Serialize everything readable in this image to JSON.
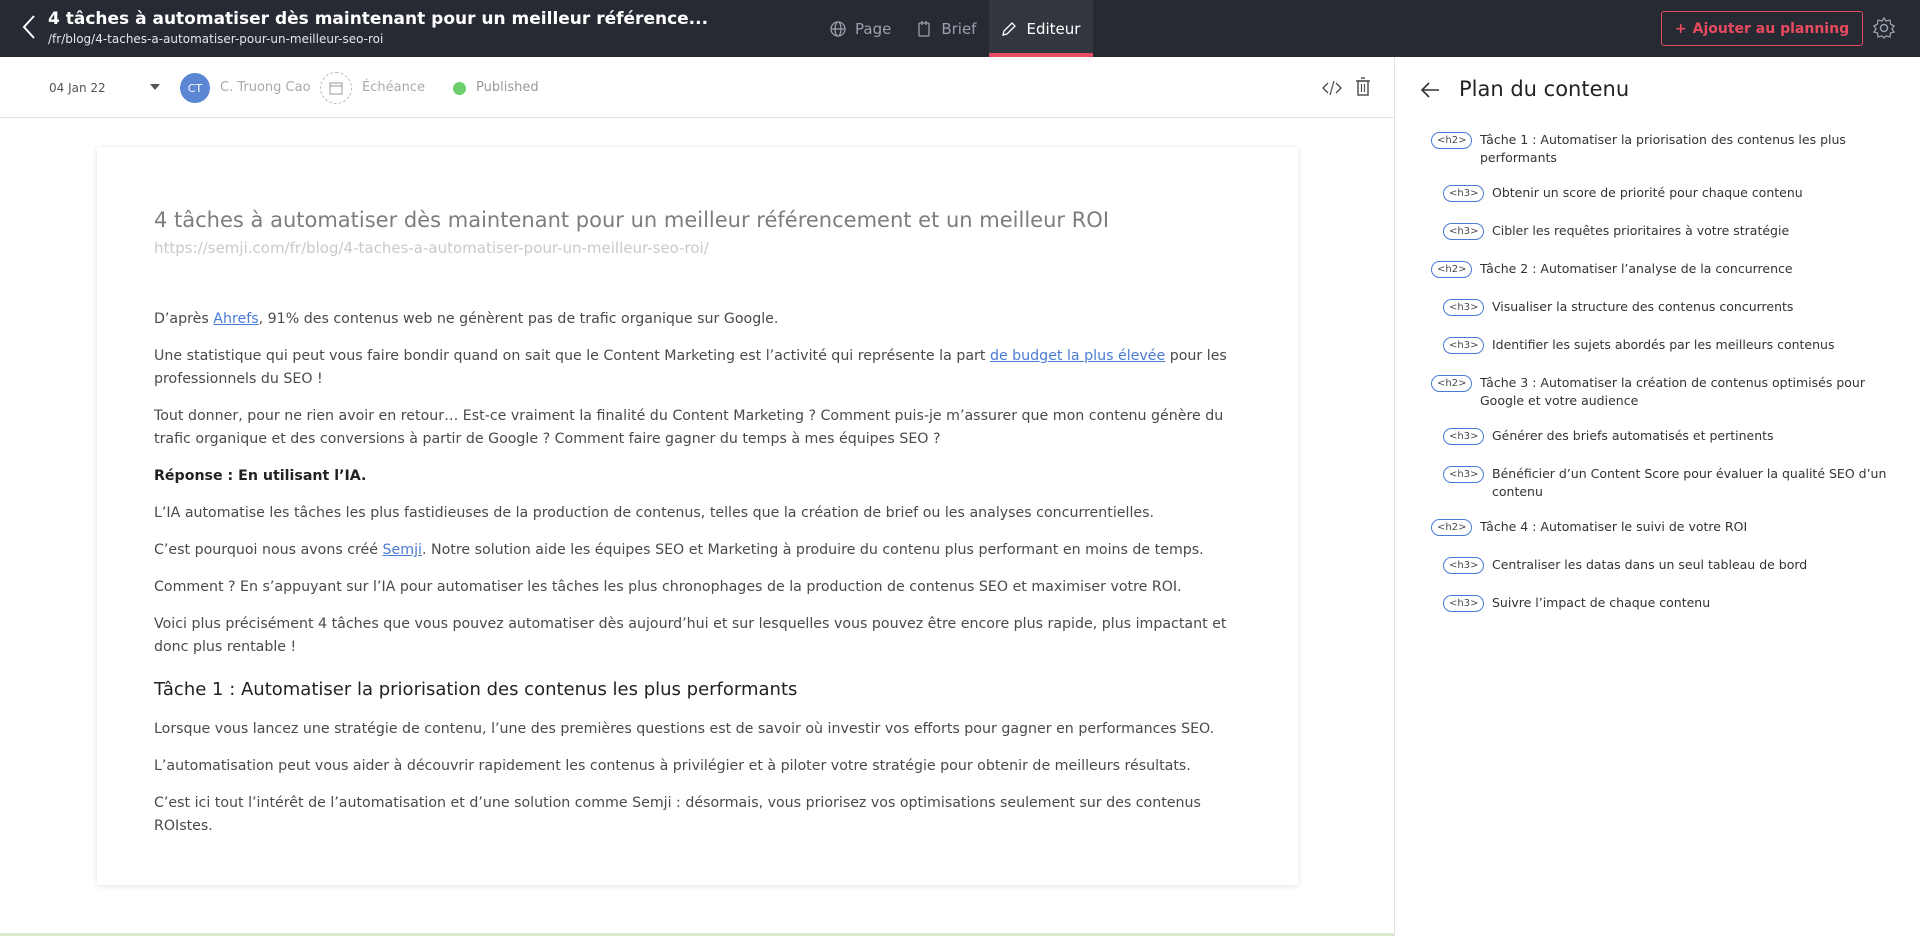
{
  "topbar": {
    "title": "4 tâches à automatiser dès maintenant pour un meilleur référence...",
    "path": "/fr/blog/4-taches-a-automatiser-pour-un-meilleur-seo-roi",
    "tabs": [
      {
        "label": "Page",
        "icon": "globe-icon"
      },
      {
        "label": "Brief",
        "icon": "brief-icon"
      },
      {
        "label": "Editeur",
        "icon": "pencil-icon",
        "active": true
      }
    ],
    "planning_button": "Ajouter au planning",
    "accent": "#e84a5f"
  },
  "meta": {
    "date": "04 Jan 22",
    "avatar_initials": "CT",
    "author": "C. Truong Cao",
    "deadline_label": "Échéance",
    "status": "Published",
    "status_color": "#6dcf6b"
  },
  "document": {
    "title": "4 tâches à automatiser dès maintenant pour un meilleur référencement et un meilleur ROI",
    "url": "https://semji.com/fr/blog/4-taches-a-automatiser-pour-un-meilleur-seo-roi/",
    "p1_pre": "D’après ",
    "p1_link": "Ahrefs",
    "p1_post": ", 91% des contenus web ne génèrent pas de trafic organique sur Google.",
    "p2_pre": "Une statistique qui peut vous faire bondir quand on sait que le Content Marketing est l’activité qui représente la part ",
    "p2_link": "de budget la plus élevée",
    "p2_post": " pour les professionnels du SEO !",
    "p3": "Tout donner, pour ne rien avoir en retour… Est-ce vraiment la finalité du Content Marketing ? Comment puis-je m’assurer que mon contenu génère du trafic organique et des conversions à partir de Google ? Comment faire gagner du temps à mes équipes SEO ?",
    "p4": "Réponse : En utilisant l’IA.",
    "p5": "L’IA automatise les tâches les plus fastidieuses de la production de contenus, telles que la création de brief ou les analyses concurrentielles.",
    "p6_pre": "C’est pourquoi nous avons créé ",
    "p6_link": "Semji",
    "p6_post": ". Notre solution aide les équipes SEO et Marketing à produire du contenu plus performant en moins de temps.",
    "p7": "Comment ? En s’appuyant sur l’IA pour automatiser les tâches les plus chronophages de la production de contenus SEO et maximiser votre ROI.",
    "p8": "Voici plus précisément 4 tâches que vous pouvez automatiser dès aujourd’hui et sur lesquelles vous pouvez être encore plus rapide, plus impactant et donc plus rentable !",
    "h2_1": "Tâche 1 : Automatiser la priorisation des contenus les plus performants",
    "p9": "Lorsque vous lancez une stratégie de contenu, l’une des premières questions est de savoir où investir vos efforts pour gagner en performances SEO.",
    "p10": "L’automatisation peut vous aider à découvrir rapidement les contenus à privilégier et à piloter votre stratégie pour obtenir de meilleurs résultats.",
    "p11": "C’est ici tout l’intérêt de l’automatisation et d’une solution comme Semji : désormais, vous priorisez vos optimisations seulement sur des contenus ROIstes."
  },
  "outline": {
    "title": "Plan du contenu",
    "items": [
      {
        "level": "h2",
        "tag": "<h2>",
        "text": "Tâche 1 : Automatiser la priorisation des contenus les plus performants"
      },
      {
        "level": "h3",
        "tag": "<h3>",
        "text": "Obtenir un score de priorité pour chaque contenu"
      },
      {
        "level": "h3",
        "tag": "<h3>",
        "text": "Cibler les requêtes prioritaires à votre stratégie"
      },
      {
        "level": "h2",
        "tag": "<h2>",
        "text": "Tâche 2 : Automatiser l’analyse de la concurrence"
      },
      {
        "level": "h3",
        "tag": "<h3>",
        "text": "Visualiser la structure des contenus concurrents"
      },
      {
        "level": "h3",
        "tag": "<h3>",
        "text": "Identifier les sujets abordés par les meilleurs contenus"
      },
      {
        "level": "h2",
        "tag": "<h2>",
        "text": "Tâche 3 : Automatiser la création de contenus optimisés pour Google et votre audience"
      },
      {
        "level": "h3",
        "tag": "<h3>",
        "text": "Générer des briefs automatisés et pertinents"
      },
      {
        "level": "h3",
        "tag": "<h3>",
        "text": "Bénéficier d’un Content Score pour évaluer la qualité SEO d’un contenu"
      },
      {
        "level": "h2",
        "tag": "<h2>",
        "text": "Tâche 4 : Automatiser le suivi de votre ROI"
      },
      {
        "level": "h3",
        "tag": "<h3>",
        "text": "Centraliser les datas dans un seul tableau de bord"
      },
      {
        "level": "h3",
        "tag": "<h3>",
        "text": "Suivre l’impact de chaque contenu"
      }
    ]
  }
}
